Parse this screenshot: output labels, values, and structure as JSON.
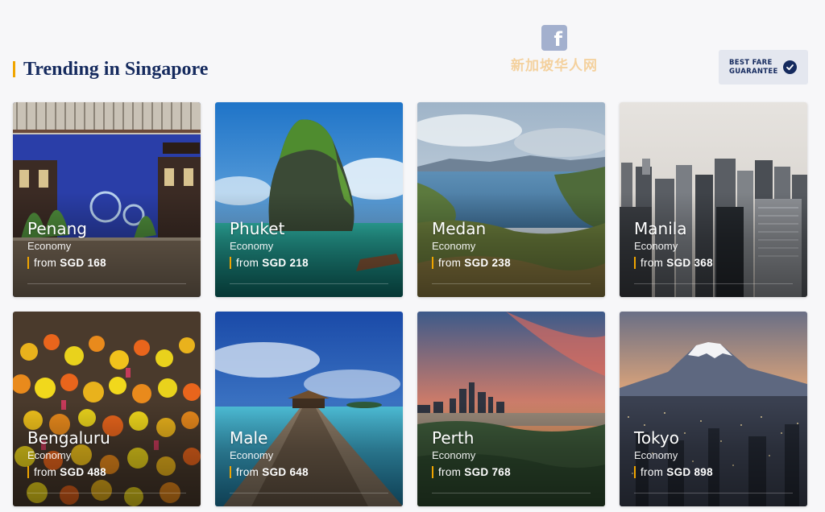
{
  "watermark": {
    "icon": "facebook-icon",
    "text": "新加坡华人网"
  },
  "header": {
    "title": "Trending in Singapore",
    "badge_line1": "BEST FARE",
    "badge_line2": "GUARANTEE"
  },
  "colors": {
    "accent": "#f0a500",
    "brand_navy": "#152a5e",
    "badge_bg": "#e4e7ef"
  },
  "destinations": [
    {
      "city": "Penang",
      "cabin": "Economy",
      "from": "from",
      "price": "SGD 168"
    },
    {
      "city": "Phuket",
      "cabin": "Economy",
      "from": "from",
      "price": "SGD 218"
    },
    {
      "city": "Medan",
      "cabin": "Economy",
      "from": "from",
      "price": "SGD 238"
    },
    {
      "city": "Manila",
      "cabin": "Economy",
      "from": "from",
      "price": "SGD 368"
    },
    {
      "city": "Bengaluru",
      "cabin": "Economy",
      "from": "from",
      "price": "SGD 488"
    },
    {
      "city": "Male",
      "cabin": "Economy",
      "from": "from",
      "price": "SGD 648"
    },
    {
      "city": "Perth",
      "cabin": "Economy",
      "from": "from",
      "price": "SGD 768"
    },
    {
      "city": "Tokyo",
      "cabin": "Economy",
      "from": "from",
      "price": "SGD 898"
    }
  ]
}
